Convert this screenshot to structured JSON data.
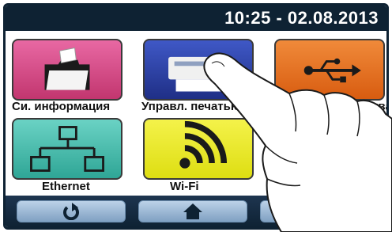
{
  "status_bar": {
    "clock": "10:25 - 02.08.2013"
  },
  "tiles": [
    {
      "label": "Си. информация",
      "icon": "folder-icon",
      "color": "#c2366f"
    },
    {
      "label": "Управл. печатью",
      "icon": "printer-icon",
      "color": "#2f3f9e"
    },
    {
      "label": "...стройства ...ов",
      "icon": "usb-icon",
      "color": "#e86a1c"
    },
    {
      "label": "Ethernet",
      "icon": "ethernet-icon",
      "color": "#3fb6a8"
    },
    {
      "label": "Wi-Fi",
      "icon": "wifi-icon",
      "color": "#e8e61e"
    }
  ],
  "bottom_bar": {
    "buttons": [
      {
        "icon": "back-icon"
      },
      {
        "icon": "home-icon"
      },
      {
        "icon": "settings-icon"
      }
    ]
  }
}
